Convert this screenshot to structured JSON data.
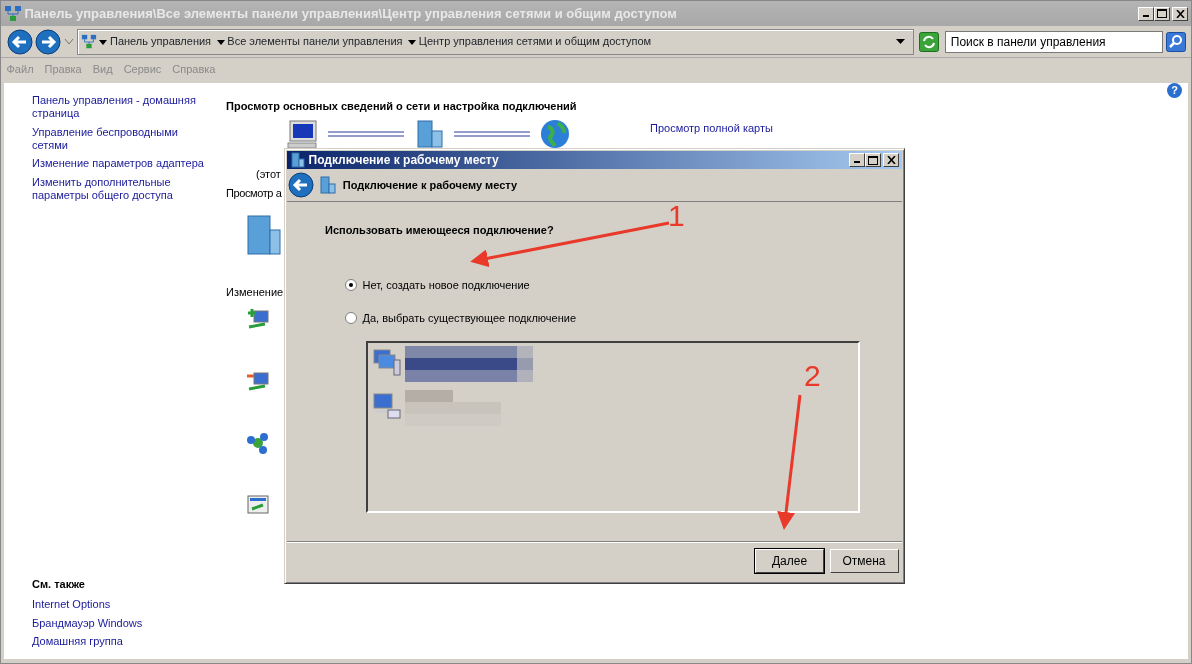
{
  "window": {
    "title": "Панель управления\\Все элементы панели управления\\Центр управления сетями и общим доступом"
  },
  "address_bar": {
    "breadcrumbs": [
      "Панель управления",
      "Все элементы панели управления",
      "Центр управления сетями и общим доступом"
    ],
    "search_placeholder": "Поиск в панели управления"
  },
  "menu": [
    "Файл",
    "Правка",
    "Вид",
    "Сервис",
    "Справка"
  ],
  "sidebar": {
    "links": [
      "Панель управления - домашняя страница",
      "Управление беспроводными сетями",
      "Изменение параметров адаптера",
      "Изменить дополнительные параметры общего доступа"
    ],
    "see_also": {
      "title": "См. также",
      "links": [
        "Internet Options",
        "Брандмауэр Windows",
        "Домашняя группа"
      ]
    }
  },
  "help": "?",
  "main": {
    "heading": "Просмотр основных сведений о сети и настройка подключений",
    "map_link": "Просмотр полной карты",
    "computer_caption": "(этот",
    "section_1": "Просмотр а",
    "section_2": "Изменение"
  },
  "dialog": {
    "title": "Подключение к рабочему месту",
    "header": "Подключение к рабочему месту",
    "question": "Использовать имеющееся подключение?",
    "options": [
      {
        "label": "Нет, создать новое подключение",
        "selected": true
      },
      {
        "label": "Да, выбрать существующее подключение",
        "selected": false
      }
    ],
    "connections": [
      {
        "kind": "network",
        "selected": true
      },
      {
        "kind": "dialup",
        "selected": false
      }
    ],
    "buttons": [
      {
        "label": "Далее",
        "default": true
      },
      {
        "label": "Отмена",
        "default": false
      }
    ]
  },
  "annotations": [
    {
      "label": "1"
    },
    {
      "label": "2"
    }
  ]
}
